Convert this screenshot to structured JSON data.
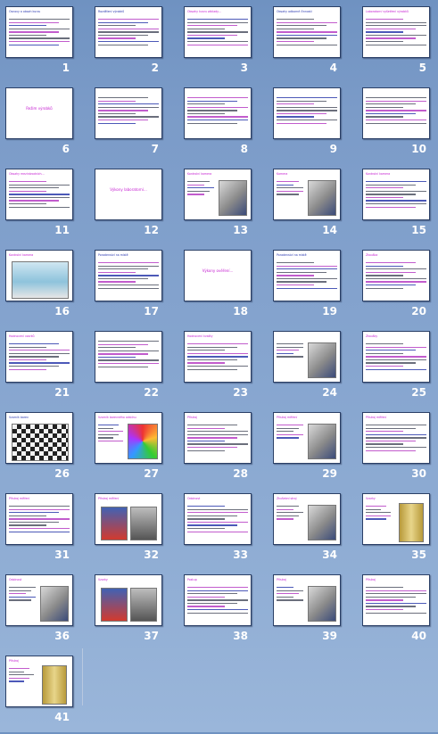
{
  "slides": [
    {
      "number": "1",
      "title": "Osnovy a obsah kurzu",
      "title_color": "#2a38b0",
      "kind": "text"
    },
    {
      "number": "2",
      "title": "Rozdělení výrobků",
      "title_color": "#2a38b0",
      "kind": "text"
    },
    {
      "number": "3",
      "title": "Obsahy kurzu základy...",
      "title_color": "#c41bd0",
      "kind": "text"
    },
    {
      "number": "4",
      "title": "Obsahy odborné činnosti",
      "title_color": "#2a38b0",
      "kind": "text"
    },
    {
      "number": "5",
      "title": "Laboratorní vyšetření výrobků",
      "title_color": "#c41bd0",
      "kind": "text"
    },
    {
      "number": "6",
      "title": "Režim výrobků",
      "title_color": "#c41bd0",
      "kind": "center"
    },
    {
      "number": "7",
      "title": "",
      "title_color": "#2a38b0",
      "kind": "text"
    },
    {
      "number": "8",
      "title": "",
      "title_color": "#2a38b0",
      "kind": "text"
    },
    {
      "number": "9",
      "title": "",
      "title_color": "#c41bd0",
      "kind": "text"
    },
    {
      "number": "10",
      "title": "",
      "title_color": "#c41bd0",
      "kind": "text"
    },
    {
      "number": "11",
      "title": "Obsahy mezinárodních...",
      "title_color": "#c41bd0",
      "kind": "text"
    },
    {
      "number": "12",
      "title": "Výkony laboratorní...",
      "title_color": "#c41bd0",
      "kind": "center"
    },
    {
      "number": "13",
      "title": "Kontrolní kamera",
      "title_color": "#c41bd0",
      "kind": "image"
    },
    {
      "number": "14",
      "title": "Kamera",
      "title_color": "#c41bd0",
      "kind": "image"
    },
    {
      "number": "15",
      "title": "Kontrolní kamera",
      "title_color": "#c41bd0",
      "kind": "text"
    },
    {
      "number": "16",
      "title": "Kontrolní kamera",
      "title_color": "#c41bd0",
      "kind": "image-wide"
    },
    {
      "number": "17",
      "title": "Poradenství na místě",
      "title_color": "#2a38b0",
      "kind": "text"
    },
    {
      "number": "18",
      "title": "Výkony ověření...",
      "title_color": "#c41bd0",
      "kind": "center"
    },
    {
      "number": "19",
      "title": "Poradenství na místě",
      "title_color": "#2a38b0",
      "kind": "text"
    },
    {
      "number": "20",
      "title": "Zkouška",
      "title_color": "#c41bd0",
      "kind": "text"
    },
    {
      "number": "21",
      "title": "Hodnocení vzorků",
      "title_color": "#c41bd0",
      "kind": "text"
    },
    {
      "number": "22",
      "title": "",
      "title_color": "#c41bd0",
      "kind": "text"
    },
    {
      "number": "23",
      "title": "Hodnocení kvality",
      "title_color": "#c41bd0",
      "kind": "text"
    },
    {
      "number": "24",
      "title": "",
      "title_color": "#2a38b0",
      "kind": "image"
    },
    {
      "number": "25",
      "title": "Zkoušky",
      "title_color": "#c41bd0",
      "kind": "text"
    },
    {
      "number": "26",
      "title": "Vzorník barev",
      "title_color": "#2a38b0",
      "kind": "checker"
    },
    {
      "number": "27",
      "title": "Vzorník barevného odstínu",
      "title_color": "#c41bd0",
      "kind": "palette"
    },
    {
      "number": "28",
      "title": "Přístroj",
      "title_color": "#c41bd0",
      "kind": "text"
    },
    {
      "number": "29",
      "title": "Přístroj měření",
      "title_color": "#c41bd0",
      "kind": "image"
    },
    {
      "number": "30",
      "title": "Přístroj měření",
      "title_color": "#c41bd0",
      "kind": "text"
    },
    {
      "number": "31",
      "title": "Přístroj měření",
      "title_color": "#c41bd0",
      "kind": "text"
    },
    {
      "number": "32",
      "title": "Přístroj měření",
      "title_color": "#c41bd0",
      "kind": "image-two"
    },
    {
      "number": "33",
      "title": "Odolnost",
      "title_color": "#c41bd0",
      "kind": "text"
    },
    {
      "number": "34",
      "title": "Zkušební stroj",
      "title_color": "#c41bd0",
      "kind": "image"
    },
    {
      "number": "35",
      "title": "Vzorky",
      "title_color": "#c41bd0",
      "kind": "image-gold"
    },
    {
      "number": "36",
      "title": "Odolnost",
      "title_color": "#c41bd0",
      "kind": "image"
    },
    {
      "number": "37",
      "title": "Vzorky",
      "title_color": "#c41bd0",
      "kind": "image-two"
    },
    {
      "number": "38",
      "title": "Postup",
      "title_color": "#c41bd0",
      "kind": "text"
    },
    {
      "number": "39",
      "title": "Přístroj",
      "title_color": "#c41bd0",
      "kind": "image"
    },
    {
      "number": "40",
      "title": "Přístroj",
      "title_color": "#c41bd0",
      "kind": "text"
    },
    {
      "number": "41",
      "title": "Přístroj",
      "title_color": "#c41bd0",
      "kind": "image-gold"
    }
  ]
}
